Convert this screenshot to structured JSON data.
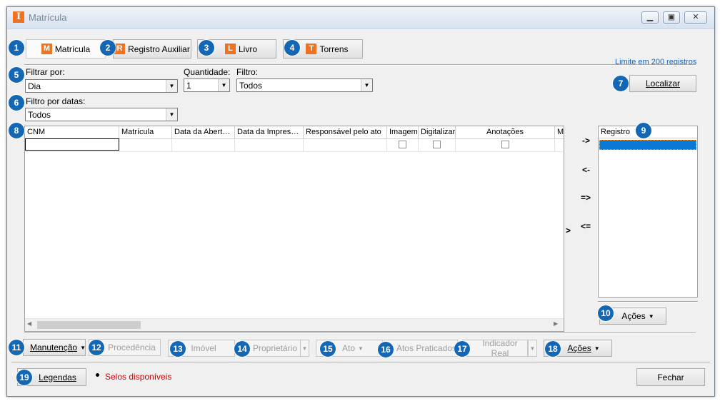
{
  "window": {
    "title": "Matrícula",
    "icon_letter": "I"
  },
  "tabs": [
    {
      "letter": "M",
      "label": "Matrícula",
      "badge": "1"
    },
    {
      "letter": "R",
      "label": "Registro Auxiliar",
      "badge": "2"
    },
    {
      "letter": "L",
      "label": "Livro",
      "badge": "3"
    },
    {
      "letter": "T",
      "label": "Torrens",
      "badge": "4"
    }
  ],
  "limit_text": "Limite em 200 registros",
  "filters": {
    "filtrar_por_label": "Filtrar por:",
    "filtrar_por_value": "Dia",
    "quantidade_label": "Quantidade:",
    "quantidade_value": "1",
    "filtro_label": "Filtro:",
    "filtro_value": "Todos",
    "filtro_datas_label": "Filtro por datas:",
    "filtro_datas_value": "Todos"
  },
  "localizar_label": "Localizar",
  "grid": {
    "columns": [
      "CNM",
      "Matrícula",
      "Data da Abert…",
      "Data da Impres…",
      "Responsável pelo ato",
      "Imagem",
      "Digitalizar",
      "Anotações",
      "Mi"
    ]
  },
  "transfer": {
    "single_right": "->",
    "single_left": "<-",
    "all_right": "=>",
    "all_left": "<=",
    "scroll_marker": ">"
  },
  "registro": {
    "header": "Registro",
    "acoes_label": "Ações"
  },
  "toolbar": {
    "manutencao": "Manutenção",
    "procedencia": "Procedência",
    "imovel": "Imóvel",
    "proprietario": "Proprietário",
    "ato": "Ato",
    "atos_praticados": "Atos Praticados",
    "indicador_real": "Indicador Real",
    "acoes": "Ações"
  },
  "footer": {
    "legendas": "Legendas",
    "selos": "Selos disponíveis",
    "fechar": "Fechar"
  },
  "badges": {
    "filtrar": "5",
    "datas": "6",
    "localizar": "7",
    "grid": "8",
    "registro": "9",
    "acoes_reg": "10",
    "manutencao": "11",
    "procedencia": "12",
    "imovel": "13",
    "proprietario": "14",
    "ato": "15",
    "atos_praticados": "16",
    "indicador_real": "17",
    "acoes": "18",
    "legendas": "19"
  },
  "colors": {
    "accent_orange": "#f0721f",
    "badge_blue": "#1467b4",
    "limit_blue": "#1d64b3",
    "selos_red": "#d40000",
    "selection_blue": "#0a78d7"
  }
}
